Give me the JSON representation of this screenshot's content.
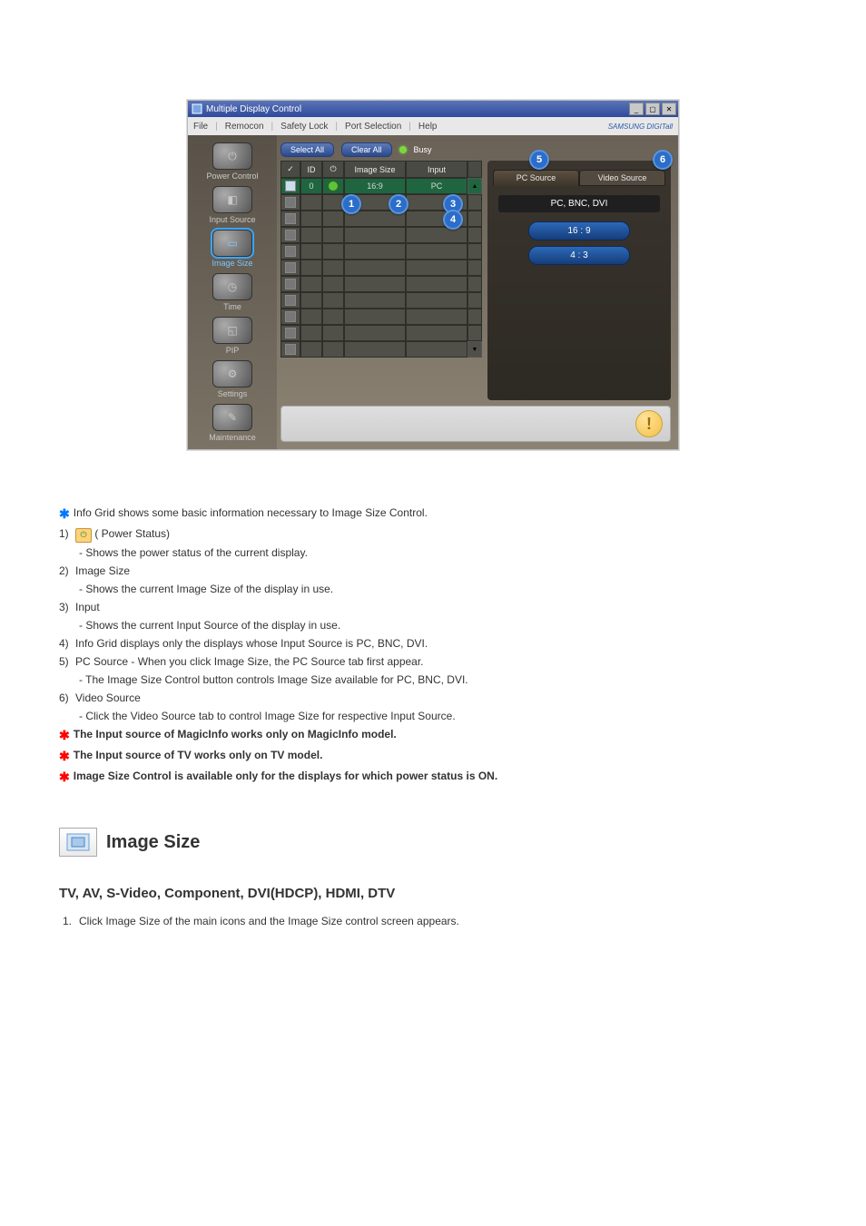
{
  "window": {
    "title": "Multiple Display Control"
  },
  "menubar": {
    "items": [
      "File",
      "Remocon",
      "Safety Lock",
      "Port Selection",
      "Help"
    ],
    "brand": "SAMSUNG DIGITall"
  },
  "sidebar": {
    "items": [
      {
        "label": "Power Control",
        "glyph": "⏻"
      },
      {
        "label": "Input Source",
        "glyph": "◧"
      },
      {
        "label": "Image Size",
        "glyph": "▭",
        "active": true
      },
      {
        "label": "Time",
        "glyph": "◷"
      },
      {
        "label": "PIP",
        "glyph": "◱"
      },
      {
        "label": "Settings",
        "glyph": "⚙"
      },
      {
        "label": "Maintenance",
        "glyph": "✎"
      }
    ]
  },
  "topbar": {
    "select_all": "Select All",
    "clear_all": "Clear All",
    "busy_label": "Busy"
  },
  "grid": {
    "headers": {
      "chk": "✓",
      "id": "ID",
      "power": "⏻",
      "imagesize": "Image Size",
      "input": "Input"
    },
    "rows": [
      {
        "checked": true,
        "id": "0",
        "power_on": true,
        "imagesize": "16:9",
        "input": "PC"
      },
      {},
      {},
      {},
      {},
      {},
      {},
      {},
      {},
      {},
      {}
    ]
  },
  "right_panel": {
    "tabs": {
      "pc": "PC Source",
      "video": "Video Source"
    },
    "source_label": "PC, BNC, DVI",
    "ratio_buttons": [
      "16 : 9",
      "4 : 3"
    ]
  },
  "callouts": [
    "1",
    "2",
    "3",
    "4",
    "5",
    "6"
  ],
  "doc": {
    "intro": "Info Grid shows some basic information necessary to Image Size Control.",
    "items": [
      {
        "num": "1)",
        "title": " ( Power Status)",
        "pre_badge": true,
        "desc": "- Shows the power status of the current display."
      },
      {
        "num": "2)",
        "title": "Image Size",
        "desc": "- Shows the current Image Size of the display in use."
      },
      {
        "num": "3)",
        "title": "Input",
        "desc": "- Shows the current Input Source of the display in use."
      },
      {
        "num": "4)",
        "title": "Info Grid displays only the displays whose Input Source is PC, BNC, DVI."
      },
      {
        "num": "5)",
        "title": "PC Source - When you click Image Size, the PC Source tab first appear.",
        "desc": "- The Image Size Control button controls Image Size available for PC, BNC, DVI."
      },
      {
        "num": "6)",
        "title": "Video Source",
        "desc": "- Click the Video Source tab to control Image Size for respective Input Source."
      }
    ],
    "red_notes": [
      "The Input source of MagicInfo works only on MagicInfo model.",
      "The Input source of TV works only on TV model.",
      "Image Size Control is available only for the displays for which power status is ON."
    ],
    "section_title": "Image Size",
    "subhead": "TV, AV, S-Video, Component, DVI(HDCP), HDMI, DTV",
    "bottom_steps": [
      {
        "num": "1.",
        "text": "Click Image Size of the main icons and the Image Size control screen appears."
      }
    ]
  }
}
